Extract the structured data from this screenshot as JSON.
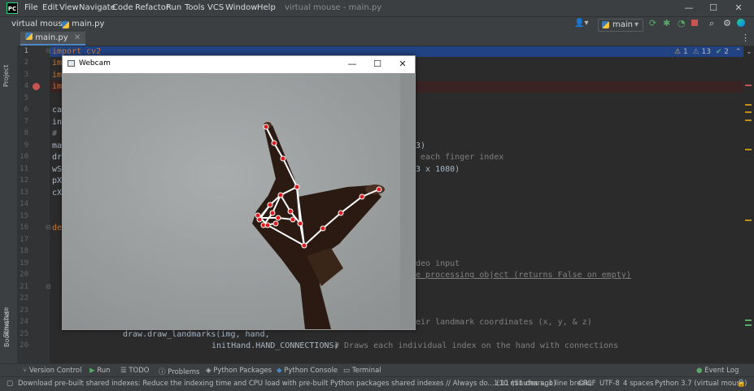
{
  "app": {
    "logo_text": "PC",
    "window_title": "virtual mouse - main.py",
    "menu": [
      "File",
      "Edit",
      "View",
      "Navigate",
      "Code",
      "Refactor",
      "Run",
      "Tools",
      "VCS",
      "Window",
      "Help"
    ],
    "window_controls": {
      "minimize": "—",
      "maximize": "☐",
      "close": "✕"
    }
  },
  "navbar": {
    "project": "virtual mouse",
    "file": "main.py",
    "branch": "main"
  },
  "tabs": [
    {
      "label": "main.py",
      "active": true
    }
  ],
  "left_strip": {
    "project": "Project",
    "structure": "Structure",
    "bookmarks": "Bookmarks"
  },
  "inspections": {
    "warnings": "1",
    "weak_warnings": "13",
    "typos": "2"
  },
  "editor": {
    "line_numbers": [
      "1",
      "2",
      "3",
      "4",
      "5",
      "6",
      "7",
      "8",
      "9",
      "10",
      "11",
      "12",
      "13",
      "14",
      "15",
      "16",
      "17",
      "18",
      "19",
      "20",
      "21",
      "22",
      "23",
      "24",
      "25",
      "26"
    ],
    "lines": [
      {
        "n": 1,
        "text": "import cv2"
      },
      {
        "n": 2,
        "text": "im"
      },
      {
        "n": 3,
        "text": "im"
      },
      {
        "n": 4,
        "text": "im"
      },
      {
        "n": 6,
        "text": "ca"
      },
      {
        "n": 7,
        "text": "in"
      },
      {
        "n": 8,
        "text": "#"
      },
      {
        "n": 9,
        "text": "ma"
      },
      {
        "n": 10,
        "text": "dr"
      },
      {
        "n": 11,
        "text": "wS"
      },
      {
        "n": 12,
        "text": "pX"
      },
      {
        "n": 13,
        "text": "cX"
      },
      {
        "n": 16,
        "text": "de"
      }
    ],
    "right_fragments": [
      {
        "n": 9,
        "text": "3)"
      },
      {
        "n": 10,
        "text": " each finger index"
      },
      {
        "n": 11,
        "text": "3 x 1080)"
      },
      {
        "n": 19,
        "text": "deo input"
      },
      {
        "n": 20,
        "text": "e processing object (returns False on empty)"
      },
      {
        "n": 24,
        "text": "eir landmark coordinates (x, y, & z)"
      }
    ],
    "line25": "draw.draw_landmarks(img, hand,",
    "line26_code": "initHand.HAND_CONNECTIONS)",
    "line26_comment": "# Draws each individual index on the hand with connections"
  },
  "webcam": {
    "title": "Webcam",
    "controls": {
      "minimize": "—",
      "maximize": "☐",
      "close": "✕"
    }
  },
  "tool_windows": [
    "Version Control",
    "Run",
    "TODO",
    "Problems",
    "Python Packages",
    "Python Console",
    "Terminal"
  ],
  "event_log": "Event Log",
  "status": {
    "message": "Download pre-built shared indexes: Reduce the indexing time and CPU load with pre-built Python packages shared indexes // Always do... (10 minutes ago)",
    "position": "1:11 (11 chars, 1 line break)",
    "line_sep": "CRLF",
    "encoding": "UTF-8",
    "indent": "4 spaces",
    "interpreter": "Python 3.7 (virtual mouse)"
  }
}
